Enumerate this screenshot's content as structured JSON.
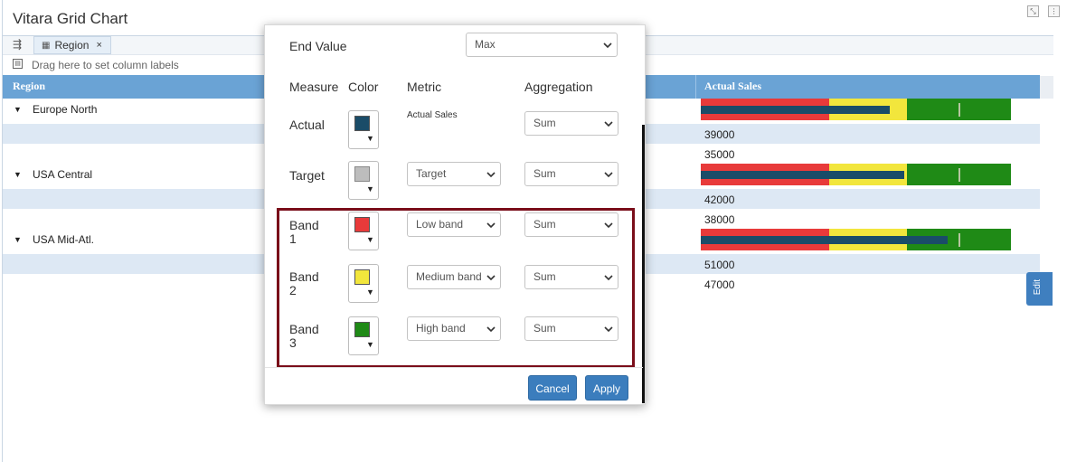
{
  "window": {
    "title": "Vitara Grid Chart",
    "minimize_glyph": "⤡",
    "more_glyph": "⋮"
  },
  "toolbar": {
    "tree_icon": "tree-icon",
    "region_chip": {
      "label": "Region",
      "close": "×"
    },
    "drag_hint": "Drag here to set column labels"
  },
  "grid": {
    "columns": [
      "Region",
      "Actual Sales"
    ],
    "groups": [
      {
        "label": "Europe North",
        "actual": 39000,
        "target": 35000,
        "sub_values": [
          "39000",
          "35000"
        ]
      },
      {
        "label": "USA Central",
        "actual": 42000,
        "target": 38000,
        "sub_values": [
          "42000",
          "38000"
        ]
      },
      {
        "label": "USA Mid-Atl.",
        "actual": 51000,
        "target": 47000,
        "sub_values": [
          "51000",
          "47000"
        ]
      }
    ],
    "bands": {
      "low": 0.415,
      "medium": 0.665,
      "high": 1.0
    },
    "bar_scale_max": 64000
  },
  "modal": {
    "end_value": {
      "label": "End Value",
      "value": "Max"
    },
    "headers": {
      "measure": "Measure",
      "color": "Color",
      "metric": "Metric",
      "aggregation": "Aggregation"
    },
    "rows": [
      {
        "measure": "Actual",
        "color": "#1a4c68",
        "metric": "Actual Sales",
        "aggregation": "Sum"
      },
      {
        "measure": "Target",
        "color": "#bdbdbd",
        "metric": "Target",
        "aggregation": "Sum"
      },
      {
        "measure_line1": "Band",
        "measure_line2": "1",
        "color": "#e83a3a",
        "metric": "Low band",
        "aggregation": "Sum"
      },
      {
        "measure_line1": "Band",
        "measure_line2": "2",
        "color": "#f2e63c",
        "metric": "Medium band",
        "aggregation": "Sum"
      },
      {
        "measure_line1": "Band",
        "measure_line2": "3",
        "color": "#1f8a16",
        "metric": "High band",
        "aggregation": "Sum"
      }
    ],
    "buttons": {
      "cancel": "Cancel",
      "apply": "Apply"
    }
  },
  "edit_tab": {
    "label": "Edit"
  },
  "colors": {
    "header": "#6aa3d5",
    "alt_row": "#dde8f4",
    "button": "#3b7dbd",
    "highlight": "#7a0e1a",
    "band_low": "#e83a3a",
    "band_medium": "#f2e63c",
    "band_high": "#1f8a16",
    "actual_bar": "#1a4c68"
  }
}
